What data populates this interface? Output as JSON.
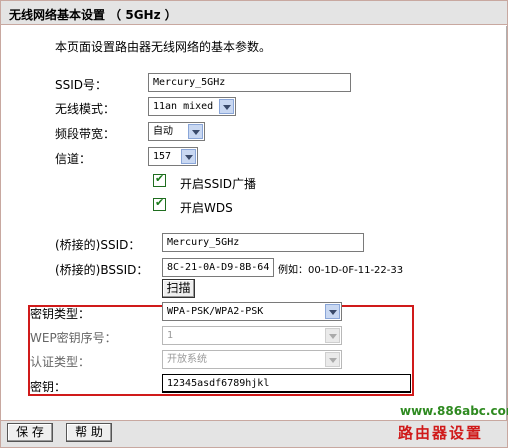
{
  "header": {
    "title": "无线网络基本设置 （ 5GHz ）"
  },
  "description": "本页面设置路由器无线网络的基本参数。",
  "basic": {
    "ssid_label": "SSID号：",
    "ssid_value": "Mercury_5GHz",
    "mode_label": "无线模式：",
    "mode_value": "11an mixed",
    "bandwidth_label": "频段带宽：",
    "bandwidth_value": "自动",
    "channel_label": "信道：",
    "channel_value": "157",
    "broadcast_label": "开启SSID广播",
    "broadcast_checked": true,
    "wds_label": "开启WDS",
    "wds_checked": true
  },
  "wds": {
    "bridge_ssid_label": "(桥接的)SSID：",
    "bridge_ssid_value": "Mercury_5GHz",
    "bridge_bssid_label": "(桥接的)BSSID：",
    "bridge_bssid_value": "8C-21-0A-D9-8B-64",
    "bssid_example": "例如：00-1D-0F-11-22-33",
    "scan_label": "扫描",
    "key_type_label": "密钥类型：",
    "key_type_value": "WPA-PSK/WPA2-PSK",
    "wep_index_label": "WEP密钥序号：",
    "wep_index_value": "1",
    "auth_type_label": "认证类型：",
    "auth_type_value": "开放系统",
    "key_label": "密钥：",
    "key_value": "12345asdf6789hjkl"
  },
  "footer": {
    "save_label": "保 存",
    "help_label": "帮 助"
  },
  "watermark": {
    "site": "www.886abc.com",
    "text": "路由器设置"
  },
  "colors": {
    "highlight_border": "#d01a1a",
    "title_bg": "#e4e4e4",
    "watermark_green": "#2e8a20"
  }
}
